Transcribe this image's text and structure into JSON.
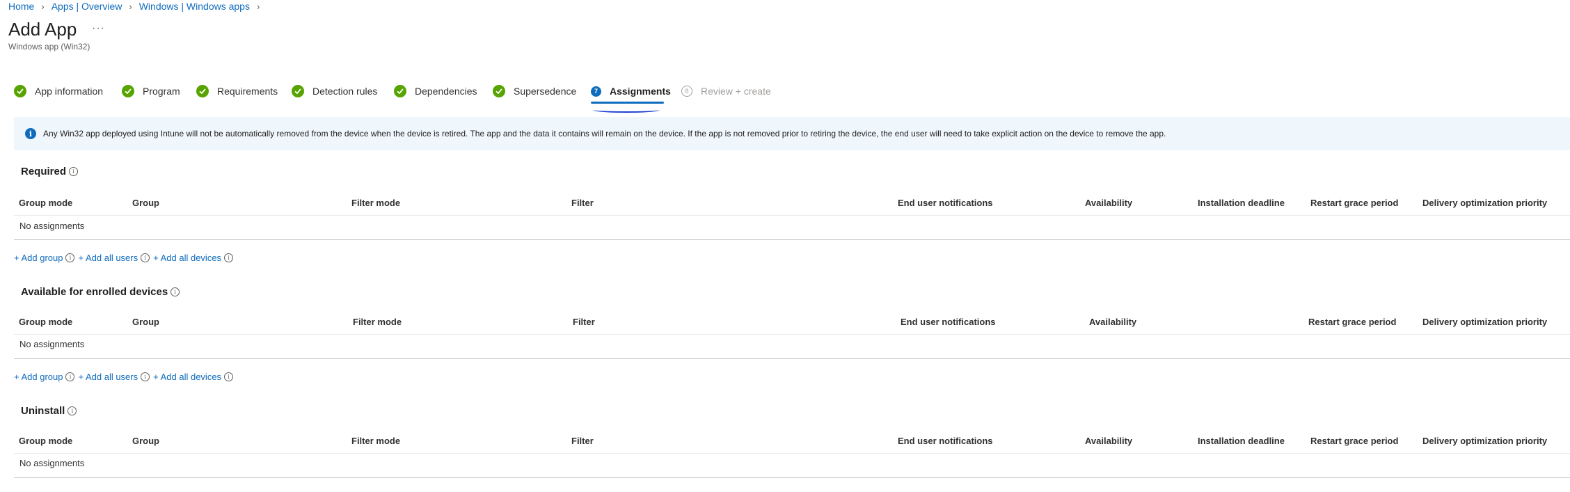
{
  "breadcrumb": {
    "items": [
      "Home",
      "Apps | Overview",
      "Windows | Windows apps"
    ]
  },
  "header": {
    "title": "Add App",
    "more": "···",
    "subtitle": "Windows app (Win32)"
  },
  "steps": [
    {
      "label": "App information",
      "state": "done"
    },
    {
      "label": "Program",
      "state": "done"
    },
    {
      "label": "Requirements",
      "state": "done"
    },
    {
      "label": "Detection rules",
      "state": "done"
    },
    {
      "label": "Dependencies",
      "state": "done"
    },
    {
      "label": "Supersedence",
      "state": "done"
    },
    {
      "label": "Assignments",
      "state": "active",
      "number": "7"
    },
    {
      "label": "Review + create",
      "state": "pending",
      "number": "8"
    }
  ],
  "banner": {
    "icon": "info-icon",
    "text": "Any Win32 app deployed using Intune will not be automatically removed from the device when the device is retired. The app and the data it contains will remain on the device. If the app is not removed prior to retiring the device, the end user will need to take explicit action on the device to remove the app."
  },
  "sections": {
    "required": {
      "title": "Required",
      "columns": [
        "Group mode",
        "Group",
        "Filter mode",
        "Filter",
        "End user notifications",
        "Availability",
        "Installation deadline",
        "Restart grace period",
        "Delivery optimization priority"
      ],
      "empty": "No assignments",
      "actions": [
        "+ Add group",
        "+ Add all users",
        "+ Add all devices"
      ]
    },
    "available": {
      "title": "Available for enrolled devices",
      "columns": [
        "Group mode",
        "Group",
        "Filter mode",
        "Filter",
        "End user notifications",
        "Availability",
        "Restart grace period",
        "Delivery optimization priority"
      ],
      "empty": "No assignments",
      "actions": [
        "+ Add group",
        "+ Add all users",
        "+ Add all devices"
      ]
    },
    "uninstall": {
      "title": "Uninstall",
      "columns": [
        "Group mode",
        "Group",
        "Filter mode",
        "Filter",
        "End user notifications",
        "Availability",
        "Installation deadline",
        "Restart grace period",
        "Delivery optimization priority"
      ],
      "empty": "No assignments"
    }
  },
  "colors": {
    "accent": "#0f6cbd",
    "success": "#57a300",
    "banner_bg": "#eff6fc"
  }
}
